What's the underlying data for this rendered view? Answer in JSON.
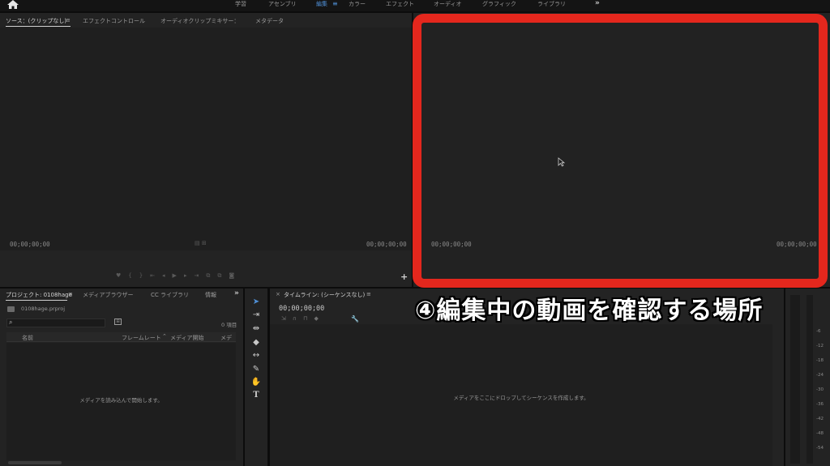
{
  "topbar": {
    "workspaces": [
      {
        "label": "学習",
        "active": false
      },
      {
        "label": "アセンブリ",
        "active": false
      },
      {
        "label": "編集",
        "active": true
      },
      {
        "label": "カラー",
        "active": false
      },
      {
        "label": "エフェクト",
        "active": false
      },
      {
        "label": "オーディオ",
        "active": false
      },
      {
        "label": "グラフィック",
        "active": false
      },
      {
        "label": "ライブラリ",
        "active": false
      }
    ],
    "menu_icon": "≡",
    "more": "»"
  },
  "source_panel": {
    "tabs": [
      "ソース：(クリップなし)",
      "エフェクトコントロール",
      "オーディオクリップミキサー：",
      "メタデータ"
    ],
    "timecode_left": "00;00;00;00",
    "timecode_right": "00;00;00;00",
    "add_button": "+"
  },
  "program_panel": {
    "timecode_left": "00;00;00;00",
    "timecode_right": "00;00;00;00"
  },
  "annotation": {
    "caption": "④編集中の動画を確認する場所",
    "color": "#e4271d"
  },
  "project_panel": {
    "tabs": [
      "プロジェクト: 0108hage",
      "メディアブラウザー",
      "CC ライブラリ",
      "情報"
    ],
    "more": "»",
    "file_name": "0108hage.prproj",
    "search_placeholder": "",
    "item_count": "0 項目",
    "columns": [
      "名前",
      "フレームレート",
      "メディア開始",
      "メディ"
    ],
    "empty_message": "メディアを読み込んで開始します。"
  },
  "timeline_panel": {
    "title": "タイムライン: (シーケンスなし)",
    "timecode": "00;00;00;00",
    "empty_message": "メディアをここにドロップしてシーケンスを作成します。"
  },
  "tools": [
    "selection-tool",
    "track-select-tool",
    "ripple-edit-tool",
    "razor-tool",
    "slip-tool",
    "pen-tool",
    "hand-tool",
    "type-tool"
  ],
  "audio_meter": {
    "ticks": [
      "-6",
      "-12",
      "-18",
      "-24",
      "-30",
      "-36",
      "-42",
      "-48",
      "-54"
    ]
  }
}
